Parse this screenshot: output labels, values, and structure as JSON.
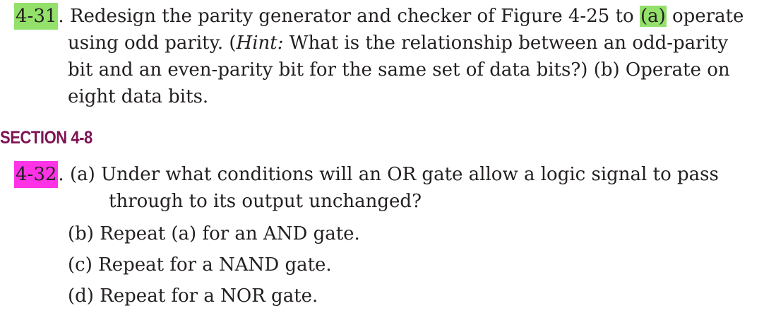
{
  "problem_31": {
    "number": "4-31",
    "line1_pre": ". Redesign the parity generator and checker of Figure 4-25 to ",
    "line1_hl": "(a)",
    "line1_post": " operate",
    "line2_pre": "using odd parity. (",
    "line2_italic": "Hint:",
    "line2_post": " What is the relationship between an odd-parity",
    "line3": "bit and an even-parity bit for the same set of data bits?) (b) Operate on",
    "line4": "eight data bits."
  },
  "section": {
    "heading": "SECTION 4-8"
  },
  "problem_32": {
    "number": "4-32",
    "line1_post": ". (a) Under what conditions will an OR gate allow a logic signal to pass",
    "line2": "through to its output unchanged?",
    "part_b": "(b) Repeat (a) for an AND gate.",
    "part_c": "(c) Repeat for a NAND gate.",
    "part_d": "(d) Repeat for a NOR gate."
  },
  "colors": {
    "highlight_green": "#93e06a",
    "highlight_magenta": "#ff33e6",
    "section_heading": "#7d1353",
    "text": "#231f20"
  }
}
